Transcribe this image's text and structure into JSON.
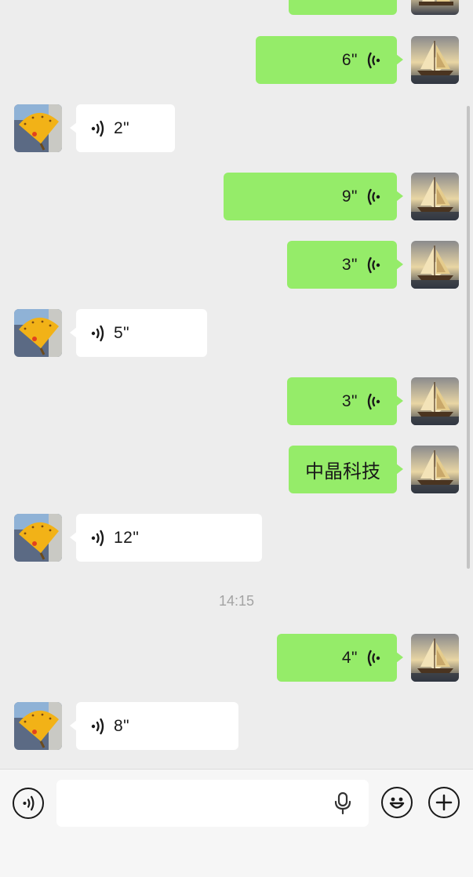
{
  "messages": [
    {
      "side": "me",
      "type": "voice",
      "duration": "6\""
    },
    {
      "side": "them",
      "type": "voice",
      "duration": "2\""
    },
    {
      "side": "me",
      "type": "voice",
      "duration": "9\""
    },
    {
      "side": "me",
      "type": "voice",
      "duration": "3\""
    },
    {
      "side": "them",
      "type": "voice",
      "duration": "5\""
    },
    {
      "side": "me",
      "type": "voice",
      "duration": "3\""
    },
    {
      "side": "me",
      "type": "text",
      "text": "中晶科技"
    },
    {
      "side": "them",
      "type": "voice",
      "duration": "12\""
    },
    {
      "side": "me",
      "type": "voice",
      "duration": "4\""
    },
    {
      "side": "them",
      "type": "voice",
      "duration": "8\""
    }
  ],
  "timestamp": "14:15",
  "input": {
    "value": "",
    "placeholder": "",
    "icons": [
      "voice-mode-icon",
      "microphone-icon",
      "emoji-icon",
      "plus-icon"
    ]
  },
  "colors": {
    "background": "#ededed",
    "my_bubble": "#95ec69",
    "their_bubble": "#ffffff",
    "timestamp": "#a3a3a3"
  }
}
